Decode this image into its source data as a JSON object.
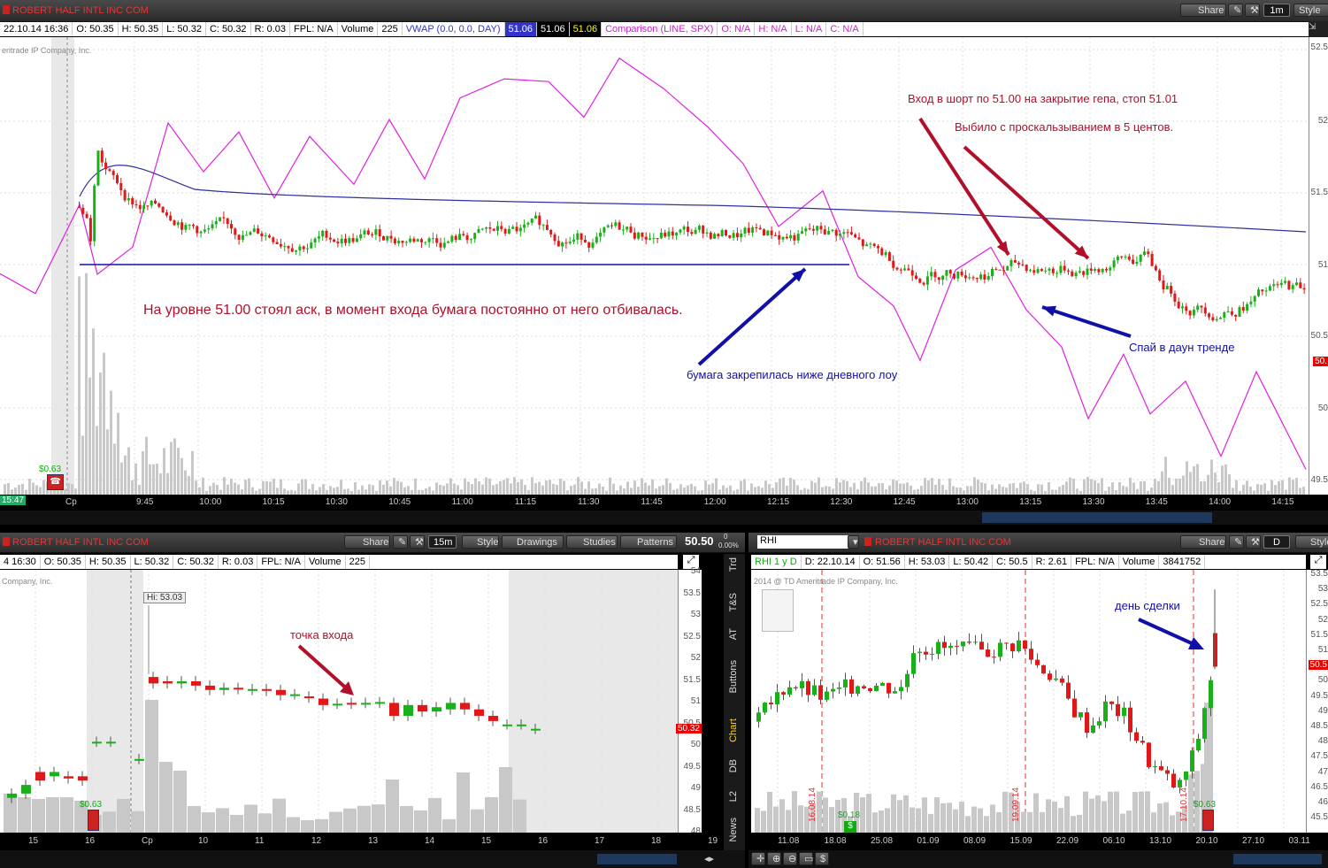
{
  "colors": {
    "up": "#19b019",
    "down": "#e01818",
    "vwap": "#3030a0",
    "spx": "#e020e0",
    "annot": "#b0102a",
    "blue": "#1010a8"
  },
  "top": {
    "title": "ROBERT HALF INTL INC COM",
    "share": "Share",
    "interval": "1m",
    "style": "Style",
    "quote": [
      "22.10.14 16:36",
      "O: 50.35",
      "H: 50.35",
      "L: 50.32",
      "C: 50.32",
      "R: 0.03",
      "FPL: N/A",
      "Volume",
      "225"
    ],
    "vwap": [
      "VWAP (0.0, 0.0, DAY)",
      "51.06",
      "51.06",
      "51.06"
    ],
    "comparison": [
      "Comparison (LINE, SPX)",
      "O: N/A",
      "H: N/A",
      "L: N/A",
      "C: N/A"
    ],
    "copyright": "eritrade IP Company, Inc.",
    "price_ticks": [
      "52.5",
      "52",
      "51.5",
      "51",
      "50.5",
      "50",
      "49.5"
    ],
    "last_price": "50.",
    "div": "$0.63",
    "time": "15:47",
    "time_ticks": [
      "Cp",
      "9:45",
      "10:00",
      "10:15",
      "10:30",
      "10:45",
      "11:00",
      "11:15",
      "11:30",
      "11:45",
      "12:00",
      "12:15",
      "12:30",
      "12:45",
      "13:00",
      "13:15",
      "13:30",
      "13:45",
      "14:00",
      "14:15"
    ],
    "annotations": {
      "entry": "Вход в шорт по 51.00 на закрытие гепа, стоп 51.01",
      "slip": "Выбило с проскальзыванием в 5 центов.",
      "ask": "На уровне 51.00 стоял аск, в момент входа бумага постоянно от него отбивалась.",
      "below": "бумага закрепилась ниже дневного лоу",
      "spy": "Спай в даун тренде"
    }
  },
  "left": {
    "title": "ROBERT HALF INTL INC COM",
    "share": "Share",
    "interval": "15m",
    "style": "Style",
    "drawings": "Drawings",
    "studies": "Studies",
    "patterns": "Patterns",
    "price": "50.50",
    "change_top": "0",
    "change_bot": "0.00%",
    "quote": [
      "4 16:30",
      "O: 50.35",
      "H: 50.35",
      "L: 50.32",
      "C: 50.32",
      "R: 0.03",
      "FPL: N/A",
      "Volume",
      "225"
    ],
    "copyright": "Company, Inc.",
    "hi": "Hi: 53.03",
    "annot": "точка входа",
    "price_ticks": [
      "54",
      "53.5",
      "53",
      "52.5",
      "52",
      "51.5",
      "51",
      "50.5",
      "50",
      "49.5",
      "49",
      "48.5",
      "48"
    ],
    "last": "50.32",
    "div": "$0.63",
    "time_ticks": [
      "15",
      "16",
      "Cp",
      "10",
      "11",
      "12",
      "13",
      "14",
      "15",
      "16",
      "17",
      "18",
      "19"
    ]
  },
  "side_tabs": [
    "Trd",
    "T&S",
    "AT",
    "Buttons",
    "Chart",
    "DB",
    "L2",
    "News"
  ],
  "right": {
    "symbol": "RHI",
    "title": "ROBERT HALF INTL INC COM",
    "share": "Share",
    "interval": "D",
    "style": "Style",
    "quote": [
      "RHI 1 y D",
      "D: 22.10.14",
      "O: 51.56",
      "H: 53.03",
      "L: 50.42",
      "C: 50.5",
      "R: 2.61",
      "FPL: N/A",
      "Volume",
      "3841752"
    ],
    "copyright": "2014 @ TD Ameritrade IP Company, Inc.",
    "annot": "день сделки",
    "price_ticks": [
      "53.5",
      "53",
      "52.5",
      "52",
      "51.5",
      "51",
      "50.5",
      "50",
      "49.5",
      "49",
      "48.5",
      "48",
      "47.5",
      "47",
      "46.5",
      "46",
      "45.5"
    ],
    "last": "50.5",
    "events": [
      "16.08.14",
      "19.09.14",
      "17.10.14"
    ],
    "div": [
      "$0.18",
      "$0.63"
    ],
    "time_ticks": [
      "11.08",
      "18.08",
      "25.08",
      "01.09",
      "08.09",
      "15.09",
      "22.09",
      "06.10",
      "13.10",
      "20.10",
      "27.10",
      "03.11"
    ]
  }
}
